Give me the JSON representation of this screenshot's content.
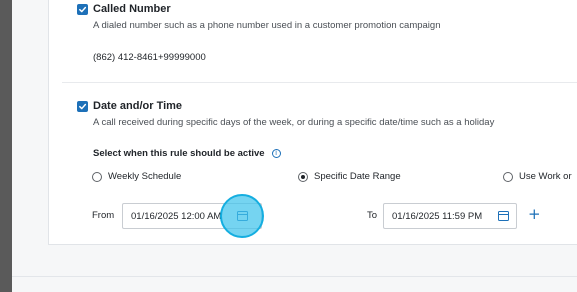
{
  "called_number": {
    "checked": true,
    "title": "Called Number",
    "description": "A dialed number such as a phone number used in a customer promotion campaign",
    "value": "(862) 412-8461+99999000"
  },
  "date_time": {
    "checked": true,
    "title": "Date and/or Time",
    "description": "A call received during specific days of the week, or during a specific date/time such as a holiday",
    "active_label": "Select when this rule should be active",
    "info_glyph": "i",
    "options": [
      {
        "label": "Weekly Schedule",
        "selected": false
      },
      {
        "label": "Specific Date Range",
        "selected": true
      },
      {
        "label": "Use Work or",
        "selected": false
      }
    ],
    "from_label": "From",
    "from_value": "01/16/2025 12:00 AM",
    "to_label": "To",
    "to_value": "01/16/2025 11:59 PM",
    "add_glyph": "+"
  },
  "colors": {
    "accent": "#1d70b8",
    "highlight": "#40c4ec"
  },
  "icons": [
    "checkbox-checked-icon",
    "info-icon",
    "calendar-icon",
    "plus-icon"
  ]
}
